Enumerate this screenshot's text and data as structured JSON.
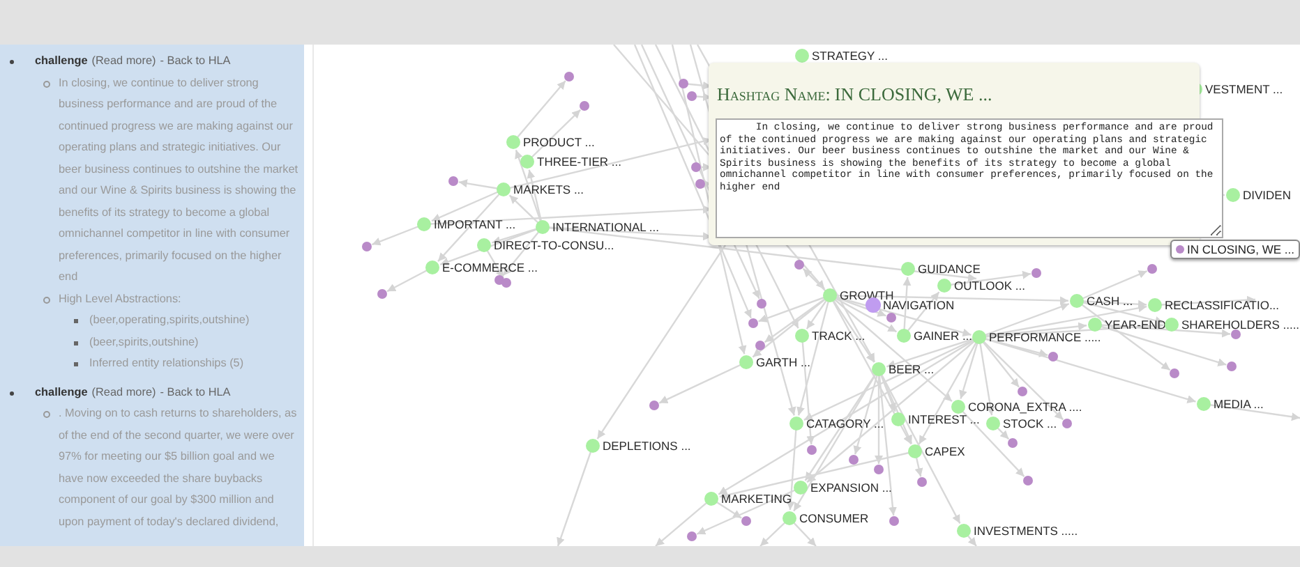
{
  "sidebar": {
    "entries": [
      {
        "title": "challenge",
        "read_more": "(Read more)",
        "back": "- Back to HLA",
        "text": "In closing, we continue to deliver strong business performance and are proud of the continued progress we are making against our operating plans and strategic initiatives. Our beer business continues to outshine the market and our Wine & Spirits business is showing the benefits of its strategy to become a global omnichannel competitor in line with consumer preferences, primarily focused on the higher end",
        "abstractions": {
          "label": "High Level Abstractions:",
          "items": [
            "(beer,operating,spirits,outshine)",
            "(beer,spirits,outshine)",
            "Inferred entity relationships (5)"
          ]
        }
      },
      {
        "title": "challenge",
        "read_more": "(Read more)",
        "back": "- Back to HLA",
        "text": ". Moving on to cash returns to shareholders, as of the end of the second quarter, we were over 97% for meeting our $5 billion goal and we have now exceeded the share buybacks component of our goal by $300 million and upon payment of today's declared dividend,"
      }
    ]
  },
  "graph": {
    "nodes": [
      {
        "label": "STRATEGY ...",
        "kind": "concept"
      },
      {
        "label": "VESTMENT ...",
        "kind": "concept"
      },
      {
        "label": "DIVIDEN",
        "kind": "concept"
      },
      {
        "label": "PRODUCT ...",
        "kind": "concept"
      },
      {
        "label": "THREE-TIER ...",
        "kind": "concept"
      },
      {
        "label": "MARKETS ...",
        "kind": "concept"
      },
      {
        "label": "IMPORTANT ...",
        "kind": "concept"
      },
      {
        "label": "INTERNATIONAL ...",
        "kind": "concept"
      },
      {
        "label": "DIRECT-TO-CONSU...",
        "kind": "concept"
      },
      {
        "label": "E-COMMERCE ...",
        "kind": "concept"
      },
      {
        "label": "GUIDANCE",
        "kind": "concept"
      },
      {
        "label": "OUTLOOK ...",
        "kind": "concept"
      },
      {
        "label": "GROWTH",
        "kind": "concept"
      },
      {
        "label": "NAVIGATION",
        "kind": "navigation"
      },
      {
        "label": "CASH ...",
        "kind": "concept"
      },
      {
        "label": "RECLASSIFICATIO...",
        "kind": "concept"
      },
      {
        "label": "YEAR-END",
        "kind": "concept"
      },
      {
        "label": "SHAREHOLDERS .....",
        "kind": "concept"
      },
      {
        "label": "TRACK ...",
        "kind": "concept"
      },
      {
        "label": "GAINER ...",
        "kind": "concept"
      },
      {
        "label": "PERFORMANCE .....",
        "kind": "concept"
      },
      {
        "label": "GARTH ...",
        "kind": "concept"
      },
      {
        "label": "BEER ...",
        "kind": "concept"
      },
      {
        "label": "CORONA_EXTRA ....",
        "kind": "concept"
      },
      {
        "label": "MEDIA ...",
        "kind": "concept"
      },
      {
        "label": "CATAGORY ...",
        "kind": "concept"
      },
      {
        "label": "INTEREST ...",
        "kind": "concept"
      },
      {
        "label": "STOCK ...",
        "kind": "concept"
      },
      {
        "label": "DEPLETIONS ...",
        "kind": "concept"
      },
      {
        "label": "CAPEX",
        "kind": "concept"
      },
      {
        "label": "EXPANSION ...",
        "kind": "concept"
      },
      {
        "label": "MARKETING",
        "kind": "concept"
      },
      {
        "label": "CONSUMER",
        "kind": "concept"
      },
      {
        "label": "INVESTMENTS .....",
        "kind": "concept"
      }
    ],
    "popup": {
      "title_label": "Hashtag Name:",
      "title": "IN CLOSING, WE ...",
      "text": "      In closing, we continue to deliver strong business performance and are proud of the continued progress we are making against our operating plans and strategic initiatives. Our beer business continues to outshine the market and our Wine & Spirits business is showing the benefits of its strategy to become a global omnichannel competitor in line with consumer preferences, primarily focused on the higher end"
    },
    "tooltip": {
      "label": "IN CLOSING, WE ..."
    }
  }
}
